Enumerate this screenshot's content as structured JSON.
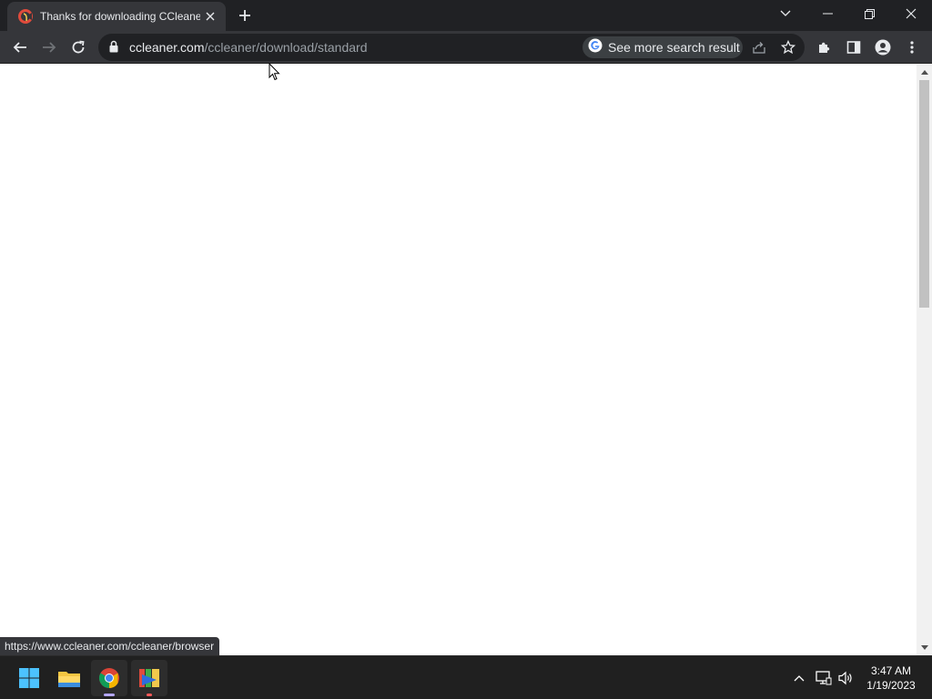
{
  "browser": {
    "tab": {
      "title": "Thanks for downloading CCleaner",
      "favicon": "ccleaner-favicon"
    },
    "omnibox": {
      "url_host": "ccleaner.com",
      "url_path": "/ccleaner/download/standard",
      "chip_label": "See more search result"
    },
    "status_bubble": "https://www.ccleaner.com/ccleaner/browser"
  },
  "taskbar": {
    "apps": [
      "windows-start-icon",
      "file-explorer-icon",
      "chrome-icon",
      "ccleaner-installer-icon"
    ],
    "clock": {
      "time": "3:47 AM",
      "date": "1/19/2023"
    }
  },
  "colors": {
    "tabbar_bg": "#202124",
    "toolbar_bg": "#35363a",
    "omnibox_bg": "#202124",
    "taskbar_bg": "#202020",
    "accent_chrome": "#8ab4f8"
  }
}
